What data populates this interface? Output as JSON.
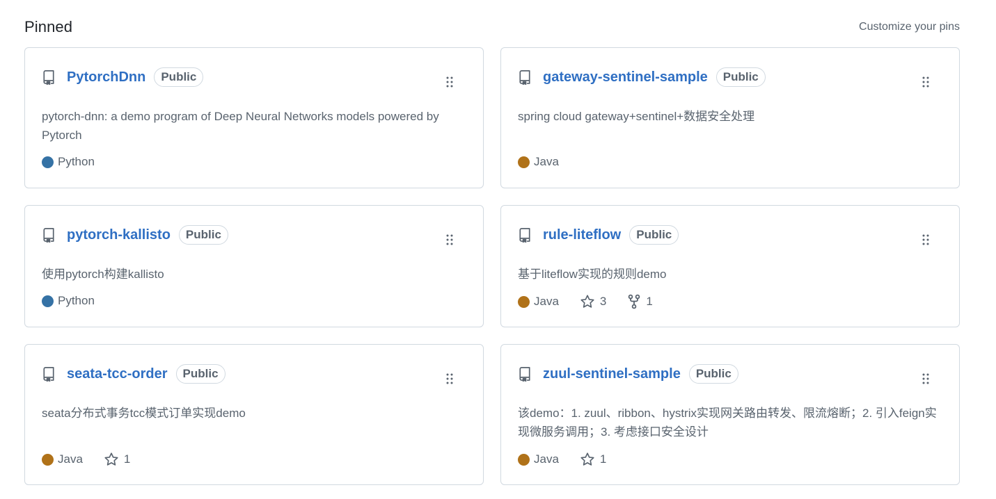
{
  "header": {
    "title": "Pinned",
    "customize_label": "Customize your pins"
  },
  "colors": {
    "link": "#2f6fc3",
    "muted": "#59636e",
    "border": "#d1d9e0",
    "python": "#3572A5",
    "java": "#b07219"
  },
  "icons": {
    "repo": "repo-icon",
    "grip": "drag-grip-icon",
    "star": "star-icon",
    "fork": "fork-icon"
  },
  "pins": [
    {
      "name": "PytorchDnn",
      "visibility": "Public",
      "description": "pytorch-dnn: a demo program of Deep Neural Networks models powered by Pytorch",
      "language": "Python",
      "language_color": "#3572A5"
    },
    {
      "name": "gateway-sentinel-sample",
      "visibility": "Public",
      "description": "spring cloud gateway+sentinel+数据安全处理",
      "language": "Java",
      "language_color": "#b07219"
    },
    {
      "name": "pytorch-kallisto",
      "visibility": "Public",
      "description": "使用pytorch构建kallisto",
      "language": "Python",
      "language_color": "#3572A5"
    },
    {
      "name": "rule-liteflow",
      "visibility": "Public",
      "description": "基于liteflow实现的规则demo",
      "language": "Java",
      "language_color": "#b07219",
      "stars": "3",
      "forks": "1"
    },
    {
      "name": "seata-tcc-order",
      "visibility": "Public",
      "description": "seata分布式事务tcc模式订单实现demo",
      "language": "Java",
      "language_color": "#b07219",
      "stars": "1"
    },
    {
      "name": "zuul-sentinel-sample",
      "visibility": "Public",
      "description": "该demo：1. zuul、ribbon、hystrix实现网关路由转发、限流熔断；2. 引入feign实现微服务调用；3. 考虑接口安全设计",
      "language": "Java",
      "language_color": "#b07219",
      "stars": "1"
    }
  ]
}
